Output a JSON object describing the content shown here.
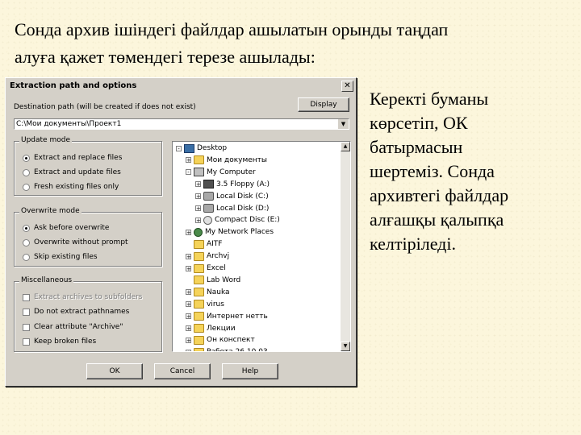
{
  "slide": {
    "intro_line1": "Сонда архив ішіндегі файлдар ашылатын орынды таңдап",
    "intro_line2": "алуға қажет төмендегі терезе ашылады:",
    "side_lines": [
      "Керекті буманы",
      "көрсетіп, ОК",
      "батырмасын",
      "шертеміз. Сонда",
      "архивтегі файлдар",
      "алғашқы қалыпқа",
      "келтіріледі."
    ]
  },
  "dialog": {
    "title": "Extraction path and options",
    "close_glyph": "✕",
    "dest_label": "Destination path (will be created if does not exist)",
    "display_button": "Display",
    "path_value": "C:\\Мои документы\\Проект1",
    "update_mode": {
      "title": "Update mode",
      "options": [
        "Extract and replace files",
        "Extract and update files",
        "Fresh existing files only"
      ],
      "selected": 0
    },
    "overwrite_mode": {
      "title": "Overwrite mode",
      "options": [
        "Ask before overwrite",
        "Overwrite without prompt",
        "Skip existing files"
      ],
      "selected": 0
    },
    "miscellaneous": {
      "title": "Miscellaneous",
      "options": [
        "Extract archives to subfolders",
        "Do not extract pathnames",
        "Clear attribute \"Archive\"",
        "Keep broken files"
      ],
      "disabled": [
        0
      ]
    },
    "tree": [
      {
        "label": "Desktop",
        "level": 0,
        "expander": "-",
        "icon": "desktop-icon"
      },
      {
        "label": "Мои документы",
        "level": 1,
        "expander": "+",
        "icon": "folder-icon"
      },
      {
        "label": "My Computer",
        "level": 1,
        "expander": "-",
        "icon": "computer-icon"
      },
      {
        "label": "3.5 Floppy (A:)",
        "level": 2,
        "expander": "+",
        "icon": "floppy-icon"
      },
      {
        "label": "Local Disk (C:)",
        "level": 2,
        "expander": "+",
        "icon": "disk-icon"
      },
      {
        "label": "Local Disk (D:)",
        "level": 2,
        "expander": "+",
        "icon": "disk-icon"
      },
      {
        "label": "Compact Disc (E:)",
        "level": 2,
        "expander": "+",
        "icon": "cd-icon"
      },
      {
        "label": "My Network Places",
        "level": 1,
        "expander": "+",
        "icon": "network-icon"
      },
      {
        "label": "AITF",
        "level": 1,
        "expander": "",
        "icon": "folder-icon"
      },
      {
        "label": "Archvj",
        "level": 1,
        "expander": "+",
        "icon": "folder-icon"
      },
      {
        "label": "Excel",
        "level": 1,
        "expander": "+",
        "icon": "folder-icon"
      },
      {
        "label": "Lab Word",
        "level": 1,
        "expander": "",
        "icon": "folder-icon"
      },
      {
        "label": "Nauka",
        "level": 1,
        "expander": "+",
        "icon": "folder-icon"
      },
      {
        "label": "virus",
        "level": 1,
        "expander": "+",
        "icon": "folder-icon"
      },
      {
        "label": "Интернет нетть",
        "level": 1,
        "expander": "+",
        "icon": "folder-icon"
      },
      {
        "label": "Лекции",
        "level": 1,
        "expander": "+",
        "icon": "folder-icon"
      },
      {
        "label": "Он конспект",
        "level": 1,
        "expander": "+",
        "icon": "folder-icon"
      },
      {
        "label": "Работа 26.10.03",
        "level": 1,
        "expander": "+",
        "icon": "folder-icon"
      }
    ],
    "ok_button": "OK",
    "cancel_button": "Cancel",
    "help_button": "Help"
  }
}
